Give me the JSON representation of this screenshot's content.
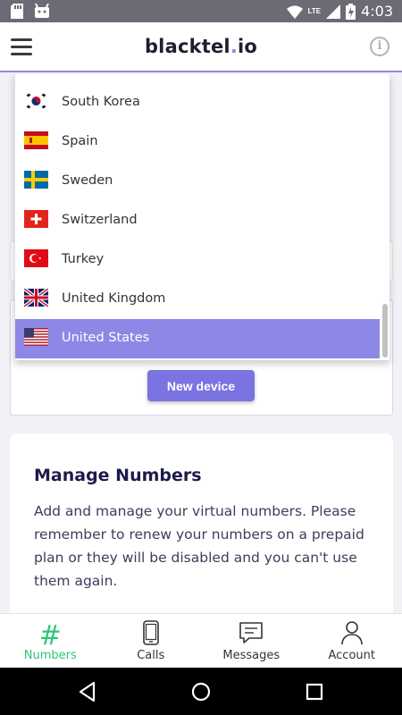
{
  "status_bar": {
    "time": "4:03",
    "network": "LTE",
    "icons": [
      "sd-card-icon",
      "android-icon",
      "wifi-icon",
      "signal-icon",
      "battery-charging-icon"
    ]
  },
  "header": {
    "brand_main": "blacktel",
    "brand_dot": ".",
    "brand_tld": "io",
    "info_icon": "i"
  },
  "country_list": {
    "items": [
      {
        "label": "South Korea",
        "flag": "kr",
        "selected": false
      },
      {
        "label": "Spain",
        "flag": "es",
        "selected": false
      },
      {
        "label": "Sweden",
        "flag": "se",
        "selected": false
      },
      {
        "label": "Switzerland",
        "flag": "ch",
        "selected": false
      },
      {
        "label": "Turkey",
        "flag": "tr",
        "selected": false
      },
      {
        "label": "United Kingdom",
        "flag": "gb",
        "selected": false
      },
      {
        "label": "United States",
        "flag": "us",
        "selected": true
      }
    ]
  },
  "device_card": {
    "new_device_label": "New device"
  },
  "manage_numbers": {
    "title": "Manage Numbers",
    "text": "Add and manage your virtual numbers. Please remember to renew your numbers on a prepaid plan or they will be disabled and you can't use them again."
  },
  "bottom_nav": {
    "items": [
      {
        "label": "Numbers",
        "icon": "hash-icon",
        "active": true
      },
      {
        "label": "Calls",
        "icon": "phone-icon",
        "active": false
      },
      {
        "label": "Messages",
        "icon": "message-icon",
        "active": false
      },
      {
        "label": "Account",
        "icon": "user-icon",
        "active": false
      }
    ]
  },
  "colors": {
    "accent": "#8d88e6",
    "button": "#7a74e2",
    "active_nav": "#2cc777",
    "title": "#1d1b4b"
  }
}
